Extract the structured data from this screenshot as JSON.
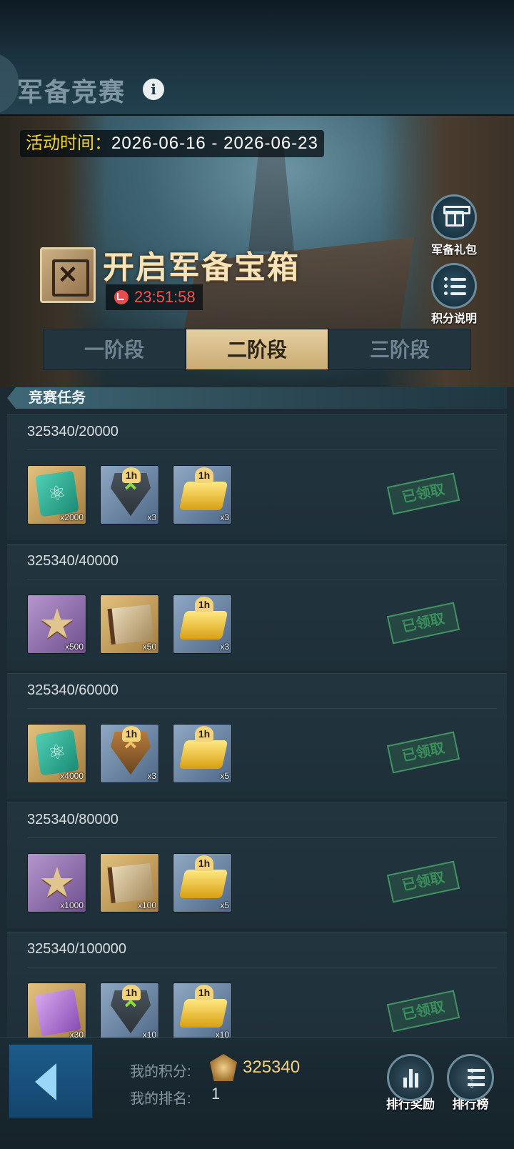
{
  "header": {
    "title": "军备竞赛",
    "info_icon": "info-icon"
  },
  "banner": {
    "time_label": "活动时间：",
    "time_range": "2026-06-16 - 2026-06-23",
    "chest_title": "开启军备宝箱",
    "countdown": "23:51:58",
    "side_buttons": [
      {
        "label": "军备礼包",
        "icon": "gift-icon"
      },
      {
        "label": "积分说明",
        "icon": "list-icon"
      }
    ]
  },
  "tabs": [
    {
      "label": "一阶段",
      "active": false
    },
    {
      "label": "二阶段",
      "active": true
    },
    {
      "label": "三阶段",
      "active": false
    }
  ],
  "section": {
    "title": "竞赛任务"
  },
  "tasks": [
    {
      "progress": "325340/20000",
      "status": "已领取",
      "rewards": [
        {
          "icon": "chip-icon",
          "qty": "x2000",
          "hour": ""
        },
        {
          "icon": "speedup-badge-icon",
          "qty": "x3",
          "hour": "1h"
        },
        {
          "icon": "gold-bar-icon",
          "qty": "x3",
          "hour": "1h"
        }
      ]
    },
    {
      "progress": "325340/40000",
      "status": "已领取",
      "rewards": [
        {
          "icon": "star-medal-icon",
          "qty": "x500",
          "hour": ""
        },
        {
          "icon": "manual-book-icon",
          "qty": "x50",
          "hour": ""
        },
        {
          "icon": "gold-bar-icon",
          "qty": "x3",
          "hour": "1h"
        }
      ]
    },
    {
      "progress": "325340/60000",
      "status": "已领取",
      "rewards": [
        {
          "icon": "chip-icon",
          "qty": "x4000",
          "hour": ""
        },
        {
          "icon": "gold-speedup-badge-icon",
          "qty": "x3",
          "hour": "1h"
        },
        {
          "icon": "gold-bar-icon",
          "qty": "x5",
          "hour": "1h"
        }
      ]
    },
    {
      "progress": "325340/80000",
      "status": "已领取",
      "rewards": [
        {
          "icon": "star-medal-icon",
          "qty": "x1000",
          "hour": ""
        },
        {
          "icon": "manual-book-icon",
          "qty": "x100",
          "hour": ""
        },
        {
          "icon": "gold-bar-icon",
          "qty": "x5",
          "hour": "1h"
        }
      ]
    },
    {
      "progress": "325340/100000",
      "status": "已领取",
      "rewards": [
        {
          "icon": "purple-card-icon",
          "qty": "x30",
          "hour": ""
        },
        {
          "icon": "speedup-badge-icon",
          "qty": "x10",
          "hour": "1h"
        },
        {
          "icon": "gold-bar-icon",
          "qty": "x10",
          "hour": "1h"
        }
      ]
    }
  ],
  "footer": {
    "score_label": "我的积分:",
    "score_value": "325340",
    "rank_label": "我的排名:",
    "rank_value": "1",
    "buttons": [
      {
        "label": "排行奖励",
        "icon": "rank-reward-icon"
      },
      {
        "label": "排行榜",
        "icon": "leaderboard-icon"
      }
    ]
  }
}
